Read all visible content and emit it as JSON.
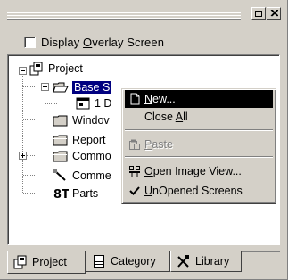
{
  "panel": {
    "caption_buttons": [
      {
        "name": "restore-button",
        "icon": "restore-icon"
      },
      {
        "name": "close-button",
        "icon": "close-icon"
      }
    ]
  },
  "overlay": {
    "label_pre": "Display ",
    "label_accel": "O",
    "label_post": "verlay Screen",
    "checked": false
  },
  "tree": {
    "nodes": [
      {
        "label": "Project",
        "icon": "project-icon",
        "expanded": true
      },
      {
        "label": "Base S",
        "icon": "folder-open-icon",
        "expanded": true,
        "selected": true
      },
      {
        "label": "1 D",
        "icon": "screen-icon"
      },
      {
        "label": "Windov",
        "icon": "folder-icon"
      },
      {
        "label": "Report",
        "icon": "folder-icon"
      },
      {
        "label": "Commo",
        "icon": "folder-icon",
        "expanded": false
      },
      {
        "label": "Comme",
        "icon": "comment-icon"
      },
      {
        "label": "Parts",
        "icon": "parts-icon"
      }
    ]
  },
  "context_menu": {
    "items": [
      {
        "accel": "N",
        "rest": "ew...",
        "icon": "new-icon",
        "enabled": true,
        "highlighted": true
      },
      {
        "pre": "Close ",
        "accel": "A",
        "rest": "ll",
        "enabled": true
      },
      {
        "accel": "P",
        "rest": "aste",
        "icon": "paste-icon",
        "enabled": false
      },
      {
        "accel": "O",
        "rest": "pen Image View...",
        "icon": "image-view-icon",
        "enabled": true
      },
      {
        "accel": "U",
        "rest": "nOpened Screens",
        "icon": "check-icon",
        "enabled": true,
        "checked": true
      }
    ]
  },
  "tabs": [
    {
      "label": "Project",
      "icon": "project-tab-icon",
      "active": true
    },
    {
      "label": "Category",
      "icon": "category-tab-icon",
      "active": false
    },
    {
      "label": "Library",
      "icon": "library-tab-icon",
      "active": false
    }
  ]
}
